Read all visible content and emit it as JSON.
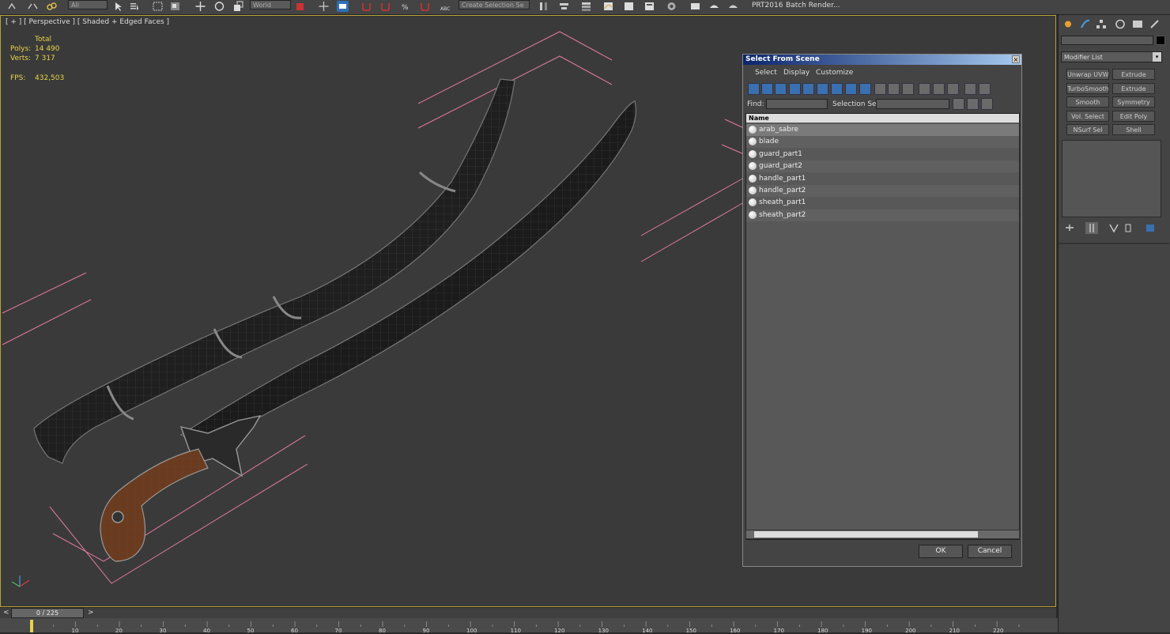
{
  "toolbar": {
    "combo_view": "All",
    "combo_coord": "World",
    "combo_selset": "Create Selection Se",
    "app_label": "PRT2016",
    "render_label": "Batch Render..."
  },
  "viewport": {
    "label": "[ + ] [ Perspective ] [ Shaded + Edged Faces ]",
    "stats": {
      "total_label": "Total",
      "polys_label": "Polys:",
      "polys_value": "14 490",
      "verts_label": "Verts:",
      "verts_value": "7 317",
      "fps_label": "FPS:",
      "fps_value": "432,503"
    }
  },
  "dialog": {
    "title": "Select From Scene",
    "close": "×",
    "menu": [
      "Select",
      "Display",
      "Customize"
    ],
    "find_label": "Find:",
    "selset_label": "Selection Set:",
    "column_name": "Name",
    "rows": [
      {
        "name": "arab_sabre",
        "selected": true
      },
      {
        "name": "blade",
        "selected": false
      },
      {
        "name": "guard_part1",
        "selected": false
      },
      {
        "name": "guard_part2",
        "selected": false
      },
      {
        "name": "handle_part1",
        "selected": false
      },
      {
        "name": "handle_part2",
        "selected": false
      },
      {
        "name": "sheath_part1",
        "selected": false
      },
      {
        "name": "sheath_part2",
        "selected": false
      }
    ],
    "ok": "OK",
    "cancel": "Cancel"
  },
  "command_panel": {
    "modifier_list": "Modifier List",
    "modifiers": [
      [
        "Unwrap UVW",
        "Extrude"
      ],
      [
        "TurboSmooth",
        "Extrude"
      ],
      [
        "Smooth",
        "Symmetry"
      ],
      [
        "Vol. Select",
        "Edit Poly"
      ],
      [
        "NSurf Sel",
        "Shell"
      ]
    ]
  },
  "timeline": {
    "frame": "0 / 225",
    "prev": "<",
    "next": ">",
    "ticks": [
      "10",
      "20",
      "30",
      "40",
      "50",
      "60",
      "70",
      "80",
      "90",
      "100",
      "110",
      "120",
      "130",
      "140",
      "150",
      "160",
      "170",
      "180",
      "190",
      "200",
      "210",
      "220"
    ]
  },
  "colors": {
    "viewport_bg": "#3a3a3a",
    "stat_text": "#e8d34a",
    "wire_pink": "#e07aa0",
    "handle_brown": "#6b3b1f",
    "title_blue": "#0a246a"
  }
}
